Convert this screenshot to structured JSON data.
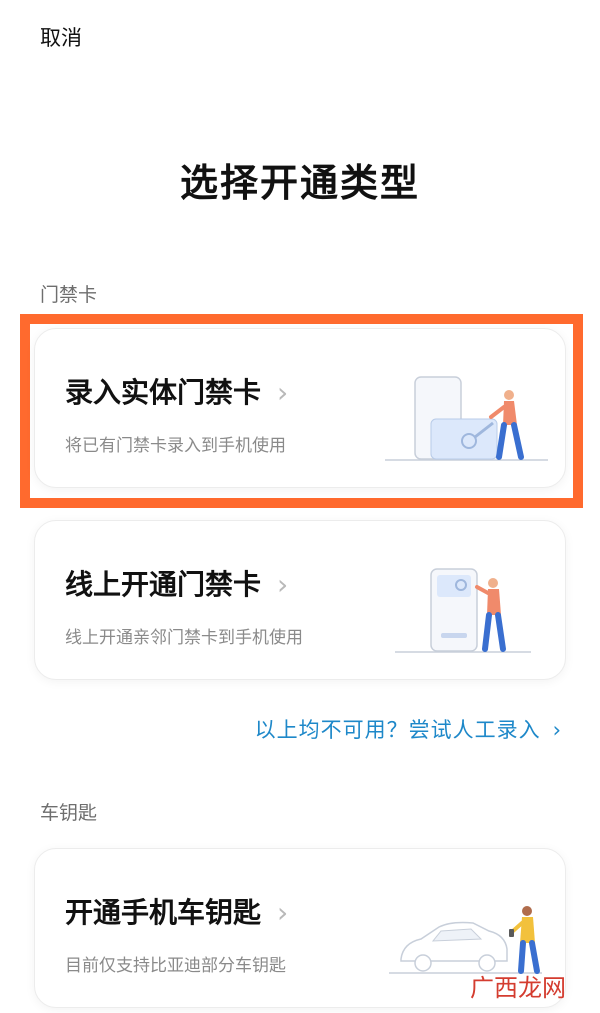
{
  "header": {
    "cancel_label": "取消"
  },
  "page_title": "选择开通类型",
  "sections": {
    "access_card_label": "门禁卡",
    "car_key_label": "车钥匙"
  },
  "cards": {
    "physical": {
      "title": "录入实体门禁卡",
      "subtitle": "将已有门禁卡录入到手机使用",
      "chevron": "›"
    },
    "online": {
      "title": "线上开通门禁卡",
      "subtitle": "线上开通亲邻门禁卡到手机使用",
      "chevron": "›"
    },
    "car_key": {
      "title": "开通手机车钥匙",
      "subtitle": "目前仅支持比亚迪部分车钥匙",
      "chevron": "›"
    }
  },
  "manual_entry": {
    "label": "以上均不可用？尝试人工录入",
    "chevron": "›"
  },
  "watermark": "广西龙网",
  "colors": {
    "highlight_border": "#ff6a2e",
    "link": "#1e88c9",
    "figure_shirt": "#f08a6b",
    "figure_pants": "#3a6fd0",
    "card_blue": "#dce8fb"
  }
}
